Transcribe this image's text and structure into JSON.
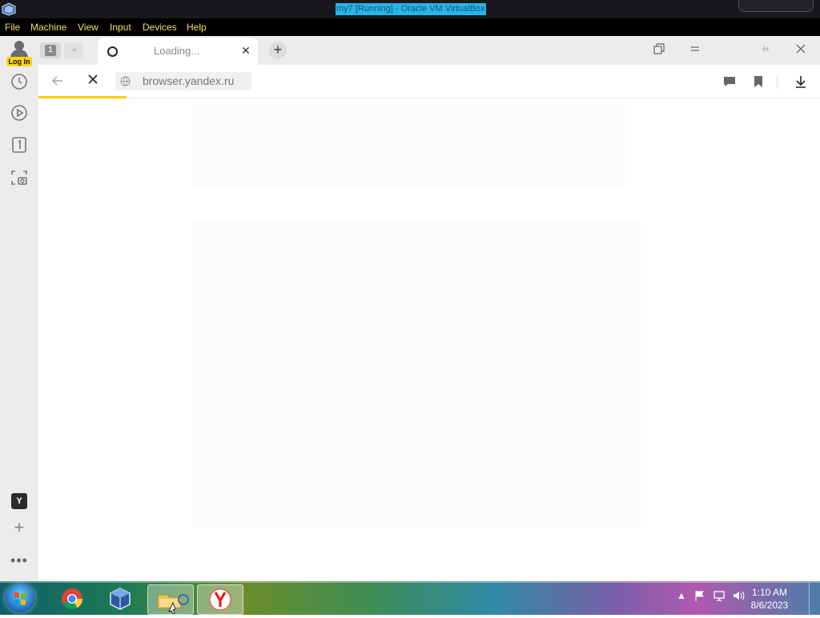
{
  "vbox": {
    "window_title": "my7 [Running] - Oracle VM VirtualBox",
    "menu": [
      "File",
      "Machine",
      "View",
      "Input",
      "Devices",
      "Help"
    ]
  },
  "browser": {
    "login_label": "Log In",
    "tab_counter": "1",
    "active_tab": {
      "title": "Loading...",
      "state": "loading"
    },
    "address": "browser.yandex.ru",
    "sidebar_y_label": "Y",
    "sidebar_more": "•••",
    "progress_color": "#ffcc00"
  },
  "taskbar": {
    "apps": [
      "start-orb",
      "chrome-icon",
      "virtualbox-icon",
      "file-explorer-icon",
      "yandex-browser-icon"
    ],
    "time": "1:10 AM",
    "date": "8/6/2023"
  },
  "colors": {
    "vbox_title_highlight": "#2ab4e8",
    "vbox_menu_text": "#f0e060",
    "login_badge": "#ffd400"
  }
}
